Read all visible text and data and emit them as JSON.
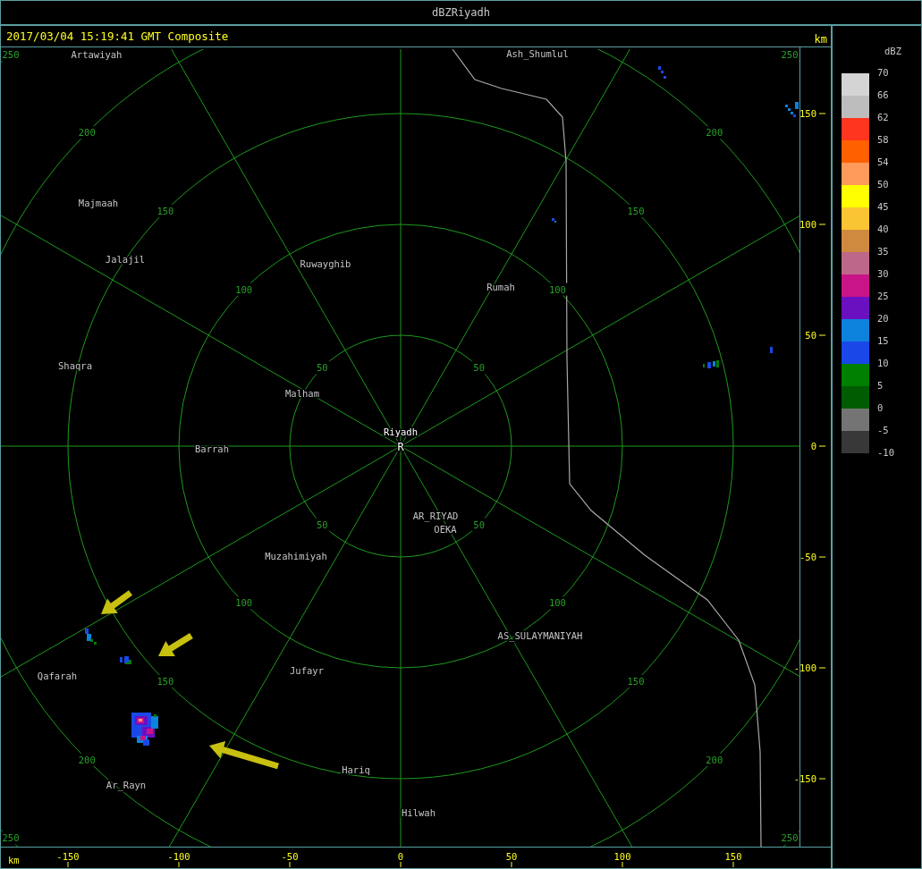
{
  "window": {
    "title": "dBZRiyadh"
  },
  "header": {
    "timestamp": "2017/03/04 15:19:41 GMT Composite",
    "unit": "km"
  },
  "map": {
    "site_marker": "R",
    "range_rings": [
      {
        "labels": [
          "50",
          "50",
          "50",
          "50"
        ]
      },
      {
        "labels": [
          "100",
          "100",
          "100",
          "100"
        ]
      },
      {
        "labels": [
          "150",
          "150",
          "150",
          "150"
        ]
      },
      {
        "labels": [
          "200",
          "200",
          "200",
          "200"
        ]
      },
      {
        "labels": [
          "250",
          "250",
          "250",
          "250"
        ]
      }
    ],
    "places": [
      {
        "name": "Artawiyah",
        "kind": "town"
      },
      {
        "name": "Ash_Shumlul",
        "kind": "town"
      },
      {
        "name": "Majmaah",
        "kind": "town"
      },
      {
        "name": "Jalajil",
        "kind": "town"
      },
      {
        "name": "Ruwayghib",
        "kind": "town"
      },
      {
        "name": "Rumah",
        "kind": "town"
      },
      {
        "name": "Shaqra",
        "kind": "town"
      },
      {
        "name": "Malham",
        "kind": "town"
      },
      {
        "name": "Riyadh",
        "kind": "radar"
      },
      {
        "name": "Barrah",
        "kind": "town"
      },
      {
        "name": "AR_RIYAD",
        "kind": "town"
      },
      {
        "name": "OEKA",
        "kind": "town"
      },
      {
        "name": "Muzahimiyah",
        "kind": "town"
      },
      {
        "name": "AS_SULAYMANIYAH",
        "kind": "town"
      },
      {
        "name": "Qafarah",
        "kind": "town"
      },
      {
        "name": "Jufayr",
        "kind": "town"
      },
      {
        "name": "Hariq",
        "kind": "town"
      },
      {
        "name": "Ar_Rayn",
        "kind": "town"
      },
      {
        "name": "Hilwah",
        "kind": "town"
      }
    ]
  },
  "y_axis": {
    "labels": [
      "150",
      "100",
      "50",
      "0",
      "-50",
      "-100",
      "-150"
    ]
  },
  "x_axis": {
    "unit": "km",
    "labels": [
      "-150",
      "-100",
      "-50",
      "0",
      "50",
      "100",
      "150"
    ]
  },
  "legend": {
    "title": "dBZ",
    "swatches": [
      {
        "color": "#d4d4d4"
      },
      {
        "color": "#bdbdbd"
      },
      {
        "color": "#ff3520"
      },
      {
        "color": "#ff6000"
      },
      {
        "color": "#ff9a5a"
      },
      {
        "color": "#ffff00"
      },
      {
        "color": "#f9c532"
      },
      {
        "color": "#cf8a40"
      },
      {
        "color": "#bd6888"
      },
      {
        "color": "#c91488"
      },
      {
        "color": "#6a10c0"
      },
      {
        "color": "#0c82dc"
      },
      {
        "color": "#1a48e8"
      },
      {
        "color": "#008000"
      },
      {
        "color": "#005c00"
      },
      {
        "color": "#747474"
      },
      {
        "color": "#383838"
      }
    ],
    "labels": [
      "70",
      "66",
      "62",
      "58",
      "54",
      "50",
      "45",
      "40",
      "35",
      "30",
      "25",
      "20",
      "15",
      "10",
      "5",
      "0",
      "-5",
      "-10"
    ]
  }
}
